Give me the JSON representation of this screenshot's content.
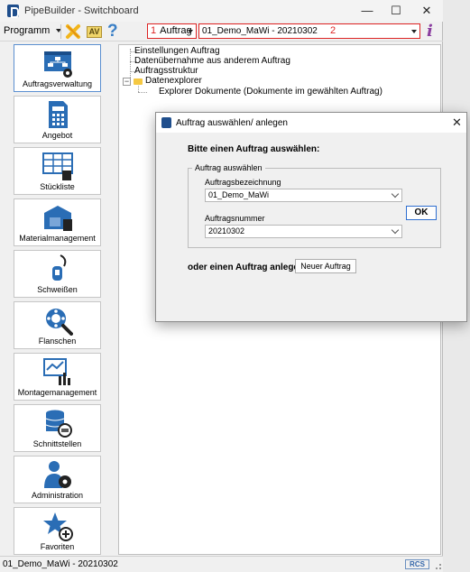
{
  "window": {
    "title": "PipeBuilder - Switchboard",
    "controls": {
      "minimize": "—",
      "maximize": "☐",
      "close": "✕"
    }
  },
  "toolbar": {
    "programm_label": "Programm",
    "auftrag_number": "1",
    "auftrag_label": "Auftrag",
    "combo_value": "01_Demo_MaWi - 20210302",
    "combo_number": "2",
    "av_label": "AV",
    "help_glyph": "?",
    "info_glyph": "i"
  },
  "sidebar": {
    "items": [
      {
        "label": "Auftragsverwaltung",
        "icon": "order-management-icon",
        "active": true
      },
      {
        "label": "Angebot",
        "icon": "calculator-document-icon"
      },
      {
        "label": "Stückliste",
        "icon": "parts-list-icon"
      },
      {
        "label": "Materialmanagement",
        "icon": "warehouse-icon"
      },
      {
        "label": "Schweißen",
        "icon": "welding-icon"
      },
      {
        "label": "Flanschen",
        "icon": "flange-search-icon"
      },
      {
        "label": "Montagemanagement",
        "icon": "assembly-chart-icon"
      },
      {
        "label": "Schnittstellen",
        "icon": "database-sync-icon"
      },
      {
        "label": "Administration",
        "icon": "admin-gear-icon"
      },
      {
        "label": "Favoriten",
        "icon": "star-plus-icon"
      }
    ]
  },
  "tree": {
    "items": [
      {
        "label": "Einstellungen Auftrag"
      },
      {
        "label": "Datenübernahme aus anderem Auftrag"
      },
      {
        "label": "Auftragsstruktur"
      },
      {
        "label": "Datenexplorer"
      },
      {
        "label": "Explorer Dokumente (Dokumente im gewählten Auftrag)"
      }
    ]
  },
  "dialog": {
    "title": "Auftrag auswählen/ anlegen",
    "close_glyph": "✕",
    "heading": "Bitte einen Auftrag auswählen:",
    "group_label": "Auftrag auswählen",
    "bezeichnung_label": "Auftragsbezeichnung",
    "bezeichnung_value": "01_Demo_MaWi",
    "nummer_label": "Auftragsnummer",
    "nummer_value": "20210302",
    "ok_label": "OK",
    "create_label": "oder einen Auftrag anlegen:",
    "new_button_label": "Neuer Auftrag"
  },
  "status": {
    "text": "01_Demo_MaWi - 20210302",
    "logo": "RCS"
  },
  "colors": {
    "accent_blue": "#1f4e8c",
    "highlight_red": "#dd2222",
    "ok_border": "#2f6fd0"
  }
}
